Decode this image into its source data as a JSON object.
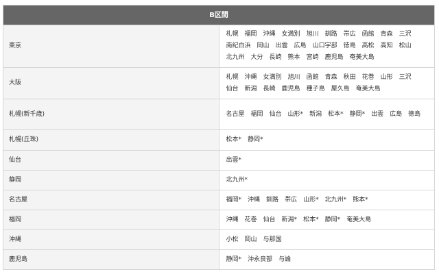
{
  "table": {
    "header": "B区間",
    "rows": [
      {
        "origin": "東京",
        "destinations": [
          "札幌",
          "福岡",
          "沖縄",
          "女満別",
          "旭川",
          "釧路",
          "帯広",
          "函館",
          "青森",
          "三沢",
          "南紀白浜",
          "岡山",
          "出雲",
          "広島",
          "山口宇部",
          "徳島",
          "高松",
          "高知",
          "松山",
          "北九州",
          "大分",
          "長崎",
          "熊本",
          "宮崎",
          "鹿児島",
          "奄美大島"
        ]
      },
      {
        "origin": "大阪",
        "destinations": [
          "札幌",
          "沖縄",
          "女満別",
          "旭川",
          "函館",
          "青森",
          "秋田",
          "花巻",
          "山形",
          "三沢",
          "仙台",
          "新潟",
          "長崎",
          "鹿児島",
          "種子島",
          "屋久島",
          "奄美大島"
        ]
      },
      {
        "origin": "札幌(新千歳)",
        "destinations": [
          "名古屋",
          "福岡",
          "仙台",
          "山形*",
          "新潟",
          "松本*",
          "静岡*",
          "出雲",
          "広島",
          "徳島"
        ]
      },
      {
        "origin": "札幌(丘珠)",
        "destinations": [
          "松本*",
          "静岡*"
        ]
      },
      {
        "origin": "仙台",
        "destinations": [
          "出雲*"
        ]
      },
      {
        "origin": "静岡",
        "destinations": [
          "北九州*"
        ]
      },
      {
        "origin": "名古屋",
        "destinations": [
          "福岡*",
          "沖縄",
          "釧路",
          "帯広",
          "山形*",
          "北九州*",
          "熊本*"
        ]
      },
      {
        "origin": "福岡",
        "destinations": [
          "沖縄",
          "花巻",
          "仙台",
          "新潟*",
          "松本*",
          "静岡*",
          "奄美大島"
        ]
      },
      {
        "origin": "沖縄",
        "destinations": [
          "小松",
          "岡山",
          "与那国"
        ]
      },
      {
        "origin": "鹿児島",
        "destinations": [
          "静岡*",
          "沖永良部",
          "与論"
        ]
      }
    ]
  }
}
